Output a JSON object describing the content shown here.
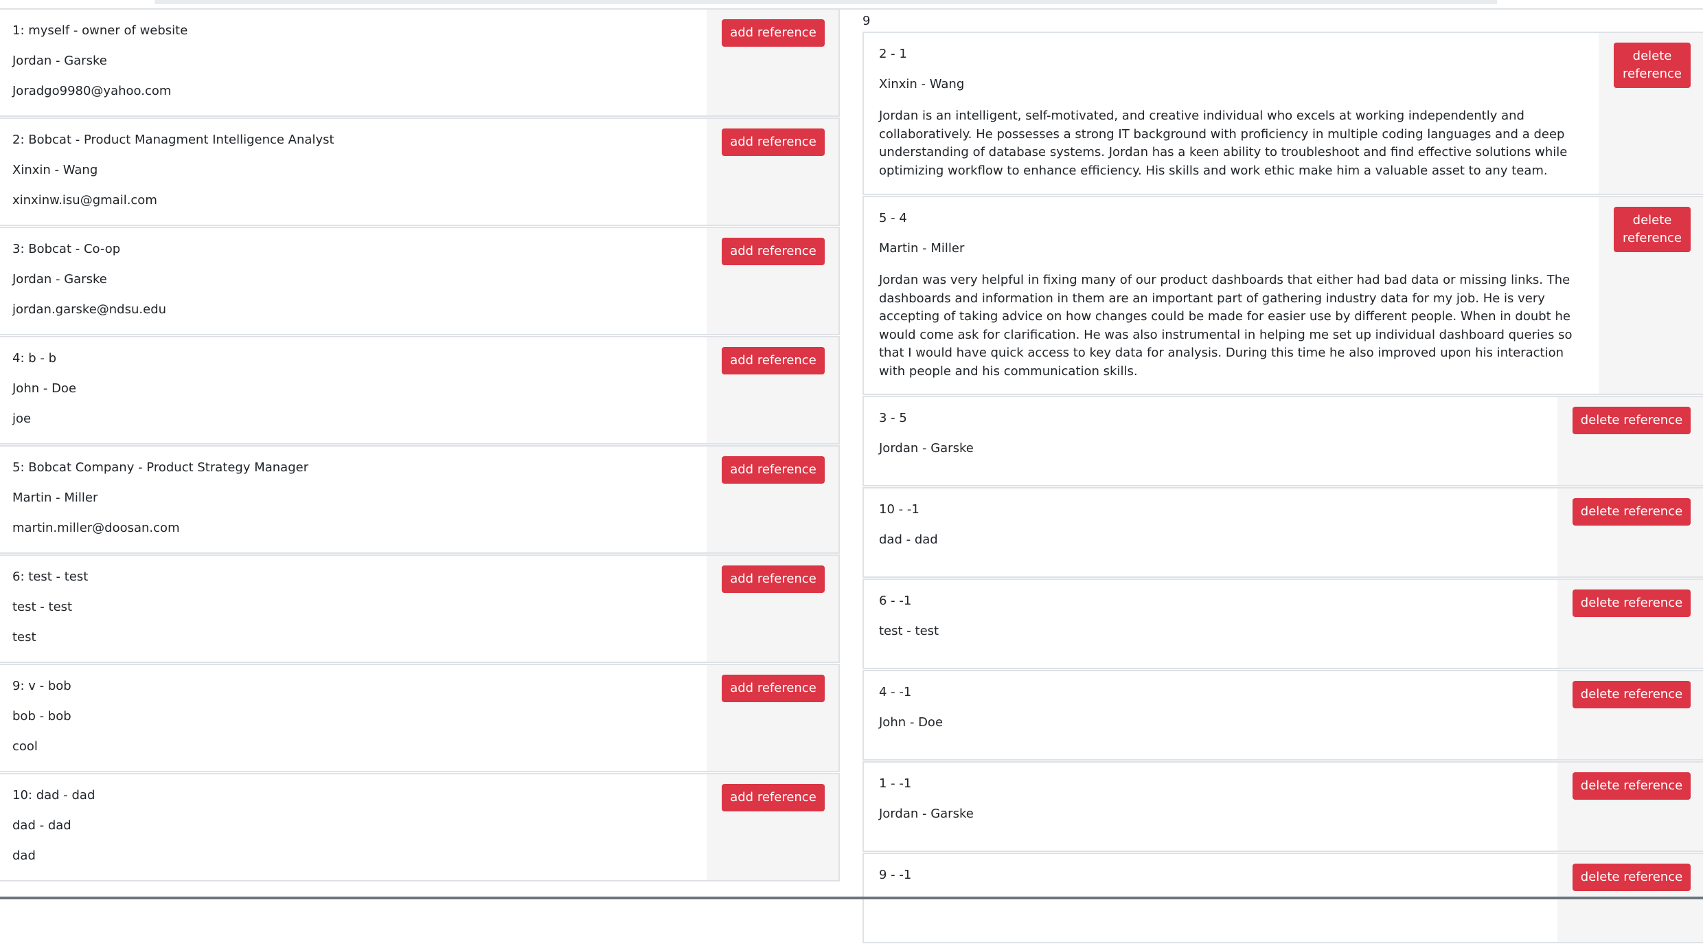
{
  "people": [
    {
      "title": "1: myself - owner of website",
      "name": "Jordan - Garske",
      "contact": "Joradgo9980@yahoo.com"
    },
    {
      "title": "2: Bobcat - Product Managment Intelligence Analyst",
      "name": "Xinxin - Wang",
      "contact": "xinxinw.isu@gmail.com"
    },
    {
      "title": "3: Bobcat - Co-op",
      "name": "Jordan - Garske",
      "contact": "jordan.garske@ndsu.edu"
    },
    {
      "title": "4: b - b",
      "name": "John - Doe",
      "contact": "joe"
    },
    {
      "title": "5: Bobcat Company - Product Strategy Manager",
      "name": "Martin - Miller",
      "contact": "martin.miller@doosan.com"
    },
    {
      "title": "6: test - test",
      "name": "test - test",
      "contact": "test"
    },
    {
      "title": "9: v - bob",
      "name": "bob - bob",
      "contact": "cool"
    },
    {
      "title": "10: dad - dad",
      "name": "dad - dad",
      "contact": "dad"
    }
  ],
  "add_label": "add reference",
  "delete_label": "delete reference",
  "delete_label_line1": "delete",
  "delete_label_line2": "reference",
  "reference_count": "9",
  "references": [
    {
      "title": "2 - 1",
      "name": "Xinxin - Wang",
      "text": "Jordan is an intelligent, self-motivated, and creative individual who excels at working independently and collaboratively. He possesses a strong IT background with proficiency in multiple coding languages and a deep understanding of database systems. Jordan has a keen ability to troubleshoot and find effective solutions while optimizing workflow to enhance efficiency. His skills and work ethic make him a valuable asset to any team."
    },
    {
      "title": "5 - 4",
      "name": "Martin - Miller",
      "text": "Jordan was very helpful in fixing many of our product dashboards that either had bad data or missing links. The dashboards and information in them are an important part of gathering industry data for my job. He is very accepting of taking advice on how changes could be made for easier use by different people. When in doubt he would come ask for clarification. He was also instrumental in helping me set up individual dashboard queries so that I would have quick access to key data for analysis. During this time he also improved upon his interaction with people and his communication skills."
    },
    {
      "title": "3 - 5",
      "name": "Jordan - Garske"
    },
    {
      "title": "10 - -1",
      "name": "dad - dad"
    },
    {
      "title": "6 - -1",
      "name": "test - test"
    },
    {
      "title": "4 - -1",
      "name": "John - Doe"
    },
    {
      "title": "1 - -1",
      "name": "Jordan - Garske"
    },
    {
      "title": "9 - -1",
      "name": ""
    }
  ]
}
